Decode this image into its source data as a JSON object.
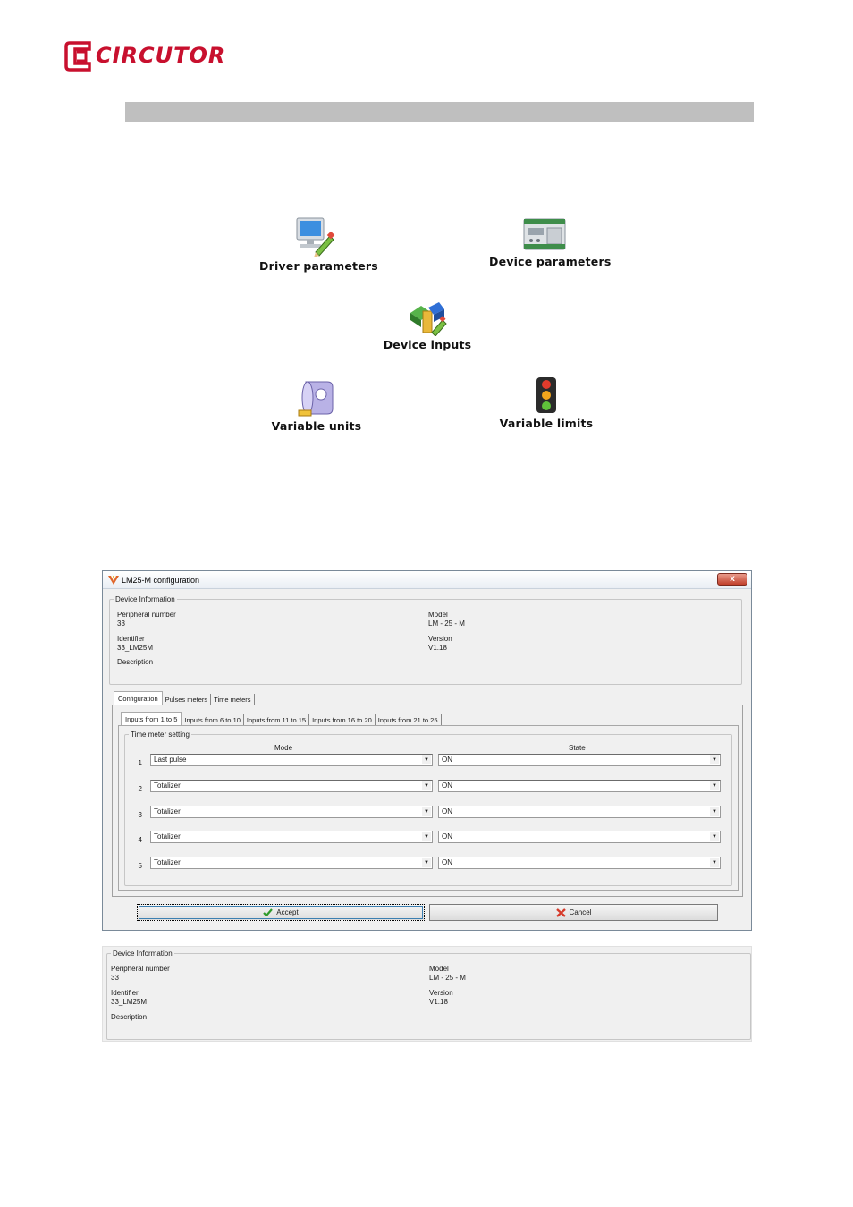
{
  "brand": {
    "name": "CIRCUTOR",
    "color": "#c8102e"
  },
  "icons": [
    {
      "label": "Driver parameters",
      "icon": "computer-pencil-icon"
    },
    {
      "label": "Device parameters",
      "icon": "din-rail-device-icon"
    },
    {
      "label": "Device inputs",
      "icon": "blocks-pencil-icon"
    },
    {
      "label": "Variable units",
      "icon": "current-transformer-icon"
    },
    {
      "label": "Variable limits",
      "icon": "traffic-light-icon"
    }
  ],
  "dialog": {
    "title": "LM25-M configuration",
    "close_label": "x",
    "device_info": {
      "legend": "Device Information",
      "peripheral_label": "Peripheral number",
      "peripheral_value": "33",
      "identifier_label": "Identifier",
      "identifier_value": "33_LM25M",
      "description_label": "Description",
      "model_label": "Model",
      "model_value": "LM - 25 - M",
      "version_label": "Version",
      "version_value": "V1.18"
    },
    "main_tabs": [
      "Configuration",
      "Pulses meters",
      "Time meters"
    ],
    "sub_tabs": [
      "Inputs from 1 to 5",
      "Inputs from 6 to 10",
      "Inputs from 11 to 15",
      "Inputs from 16 to 20",
      "Inputs from 21 to 25"
    ],
    "group_legend": "Time meter setting",
    "mode_header": "Mode",
    "state_header": "State",
    "rows": [
      {
        "num": "1",
        "mode": "Last pulse",
        "state": "ON"
      },
      {
        "num": "2",
        "mode": "Totalizer",
        "state": "ON"
      },
      {
        "num": "3",
        "mode": "Totalizer",
        "state": "ON"
      },
      {
        "num": "4",
        "mode": "Totalizer",
        "state": "ON"
      },
      {
        "num": "5",
        "mode": "Totalizer",
        "state": "ON"
      }
    ],
    "accept_label": "Accept",
    "cancel_label": "Cancel"
  },
  "crop": {
    "legend": "Device Information",
    "peripheral_label": "Peripheral number",
    "peripheral_value": "33",
    "identifier_label": "Identifier",
    "identifier_value": "33_LM25M",
    "description_label": "Description",
    "model_label": "Model",
    "model_value": "LM - 25 - M",
    "version_label": "Version",
    "version_value": "V1.18"
  }
}
